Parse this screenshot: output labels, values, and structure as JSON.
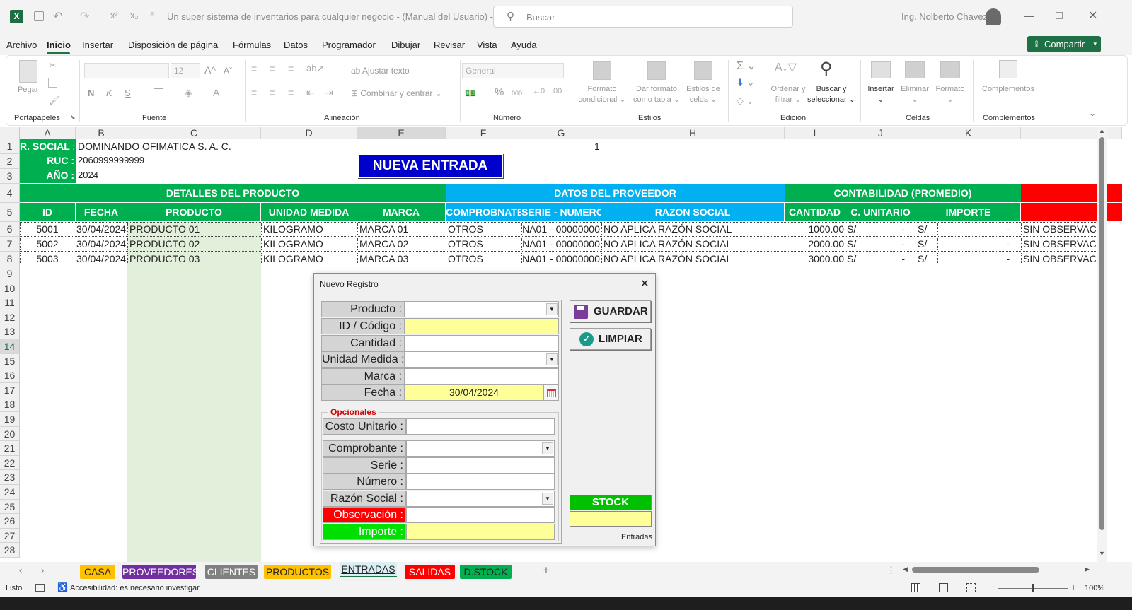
{
  "titlebar": {
    "doc_title": "Un super sistema de inventarios para cualquier negocio - (Manual del Usuario)  -  E...",
    "search_placeholder": "Buscar",
    "user": "Ing. Nolberto Chavez"
  },
  "menu": [
    "Archivo",
    "Inicio",
    "Insertar",
    "Disposición de página",
    "Fórmulas",
    "Datos",
    "Programador",
    "Dibujar",
    "Revisar",
    "Vista",
    "Ayuda"
  ],
  "share_label": "Compartir",
  "ribbon": {
    "paste": "Pegar",
    "font_size": "12",
    "bold": "N",
    "italic": "K",
    "underline": "S",
    "wrap_text": "Ajustar texto",
    "merge_center": "Combinar y centrar",
    "number_format": "General",
    "percent": "%",
    "thousands": "000",
    "cond_format_1": "Formato",
    "cond_format_2": "condicional",
    "table_format_1": "Dar formato",
    "table_format_2": "como tabla",
    "cell_styles_1": "Estilos de",
    "cell_styles_2": "celda",
    "sort_filter_1": "Ordenar y",
    "sort_filter_2": "filtrar",
    "find_select_1": "Buscar y",
    "find_select_2": "seleccionar",
    "insert": "Insertar",
    "delete": "Eliminar",
    "format": "Formato",
    "addins": "Complementos",
    "groups": {
      "portapapeles": "Portapapeles",
      "fuente": "Fuente",
      "alineacion": "Alineación",
      "numero": "Número",
      "estilos": "Estilos",
      "edicion": "Edición",
      "celdas": "Celdas",
      "complementos": "Complementos"
    }
  },
  "columns": [
    "A",
    "B",
    "C",
    "D",
    "E",
    "F",
    "G",
    "H",
    "I",
    "J",
    "K"
  ],
  "rows": [
    "1",
    "2",
    "3",
    "4",
    "5",
    "6",
    "7",
    "8",
    "9",
    "10",
    "11",
    "12",
    "13",
    "14",
    "15",
    "16",
    "17",
    "18",
    "19",
    "20",
    "21",
    "22",
    "23",
    "24",
    "25",
    "26",
    "27",
    "28"
  ],
  "info": {
    "rsocial_label": "R. SOCIAL :",
    "rsocial_value": "DOMINANDO OFIMATICA S. A. C.",
    "ruc_label": "RUC :",
    "ruc_value": "2060999999999",
    "anio_label": "AÑO :",
    "anio_value": "2024",
    "g1_value": "1"
  },
  "nueva_entrada": "NUEVA ENTRADA",
  "group_headers": {
    "producto": "DETALLES DEL PRODUCTO",
    "proveedor": "DATOS DEL PROVEEDOR",
    "contabilidad": "CONTABILIDAD (PROMEDIO)"
  },
  "col_headers": [
    "ID",
    "FECHA",
    "PRODUCTO",
    "UNIDAD MEDIDA",
    "MARCA",
    "COMPROBNATE",
    "SERIE - NUMERO",
    "RAZON SOCIAL",
    "CANTIDAD",
    "C. UNITARIO",
    "IMPORTE"
  ],
  "table_rows": [
    {
      "id": "5001",
      "fecha": "30/04/2024",
      "producto": "PRODUCTO 01",
      "unidad": "KILOGRAMO",
      "marca": "MARCA 01",
      "comprobante": "OTROS",
      "serie": "NA01 - 00000000",
      "razon": "NO APLICA RAZÓN SOCIAL",
      "cantidad": "1000.00",
      "cu_cur": "S/",
      "cu_val": "-",
      "imp_cur": "S/",
      "imp_val": "-",
      "obs": "SIN OBSERVACIO"
    },
    {
      "id": "5002",
      "fecha": "30/04/2024",
      "producto": "PRODUCTO 02",
      "unidad": "KILOGRAMO",
      "marca": "MARCA 02",
      "comprobante": "OTROS",
      "serie": "NA01 - 00000000",
      "razon": "NO APLICA RAZÓN SOCIAL",
      "cantidad": "2000.00",
      "cu_cur": "S/",
      "cu_val": "-",
      "imp_cur": "S/",
      "imp_val": "-",
      "obs": "SIN OBSERVACIO"
    },
    {
      "id": "5003",
      "fecha": "30/04/2024",
      "producto": "PRODUCTO 03",
      "unidad": "KILOGRAMO",
      "marca": "MARCA 03",
      "comprobante": "OTROS",
      "serie": "NA01 - 00000000",
      "razon": "NO APLICA RAZÓN SOCIAL",
      "cantidad": "3000.00",
      "cu_cur": "S/",
      "cu_val": "-",
      "imp_cur": "S/",
      "imp_val": "-",
      "obs": "SIN OBSERVACIO"
    }
  ],
  "dialog": {
    "title": "Nuevo Registro",
    "close": "✕",
    "labels": {
      "producto": "Producto :",
      "id": "ID / Código :",
      "cantidad": "Cantidad :",
      "unidad": "Unidad Medida :",
      "marca": "Marca :",
      "fecha": "Fecha :",
      "opcionales": "Opcionales",
      "costo": "Costo Unitario :",
      "comprobante": "Comprobante :",
      "serie": "Serie :",
      "numero": "Número :",
      "razon": "Razón Social :",
      "observacion": "Observación :",
      "importe": "Importe :"
    },
    "fecha_value": "30/04/2024",
    "guardar": "GUARDAR",
    "limpiar": "LIMPIAR",
    "stock": "STOCK",
    "footer": "Entradas"
  },
  "sheet_tabs": [
    {
      "label": "CASA",
      "bg": "#ffc000",
      "fg": "#222"
    },
    {
      "label": "PROVEEDORES",
      "bg": "#7030a0",
      "fg": "#fff"
    },
    {
      "label": "CLIENTES",
      "bg": "#808080",
      "fg": "#fff"
    },
    {
      "label": "PRODUCTOS",
      "bg": "#ffc000",
      "fg": "#222"
    },
    {
      "label": "ENTRADAS",
      "bg": "#daeef3",
      "fg": "#222"
    },
    {
      "label": "SALIDAS",
      "bg": "#ff0000",
      "fg": "#fff"
    },
    {
      "label": "D.STOCK",
      "bg": "#00b050",
      "fg": "#222"
    }
  ],
  "status": {
    "ready": "Listo",
    "accessibility": "Accesibilidad: es necesario investigar",
    "zoom": "100%"
  },
  "colors": {
    "green": "#00b050",
    "blue": "#00b0f0",
    "red": "#ff0000",
    "navy": "#0000cc",
    "yellow": "#ffff99",
    "light_green_col": "#e2efda",
    "excel_green": "#217346"
  }
}
